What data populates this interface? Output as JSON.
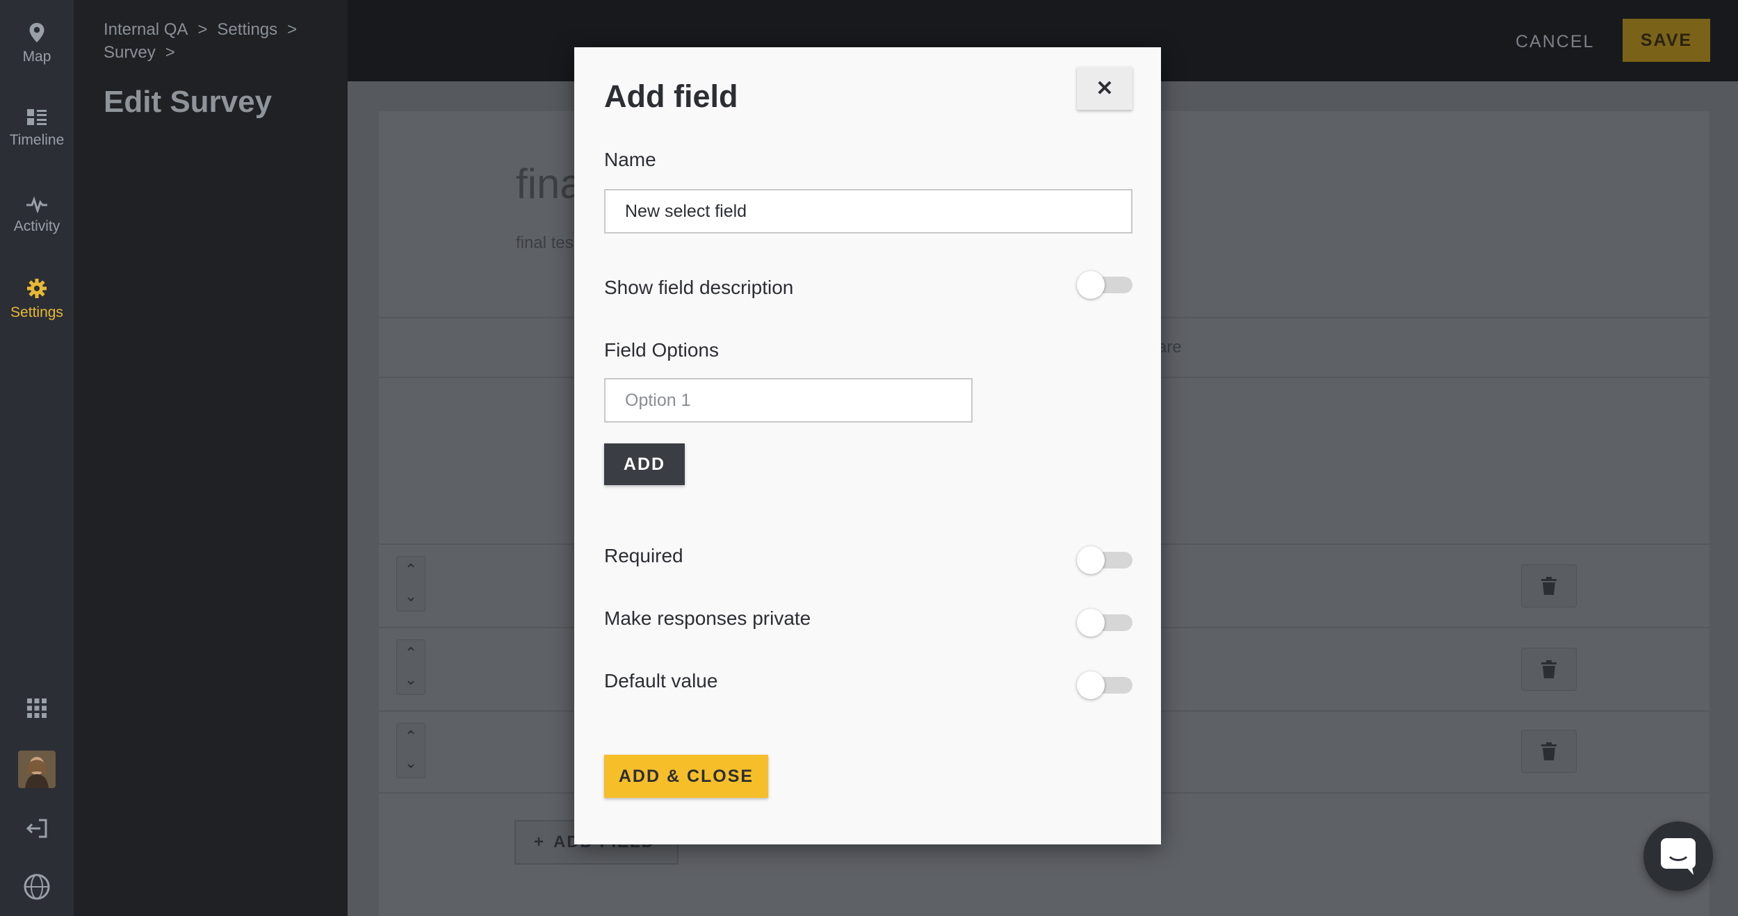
{
  "rail": {
    "items": [
      {
        "label": "Map",
        "icon": "map-pin-icon"
      },
      {
        "label": "Timeline",
        "icon": "timeline-icon"
      },
      {
        "label": "Activity",
        "icon": "activity-icon"
      },
      {
        "label": "Settings",
        "icon": "gear-icon"
      }
    ],
    "bottom_icons": [
      "apps-grid-icon",
      "avatar",
      "logout-icon",
      "globe-icon"
    ],
    "active_color": "#e9b935"
  },
  "sidebar": {
    "breadcrumb": [
      "Internal QA",
      "Settings",
      "Survey"
    ],
    "separator": ">",
    "title": "Edit Survey"
  },
  "header": {
    "cancel_label": "CANCEL",
    "save_label": "SAVE"
  },
  "background": {
    "survey_title_partial": "fina",
    "survey_desc_partial": "final tes",
    "share_partial": "are",
    "add_field_partial": "ADD FIELD"
  },
  "modal": {
    "title": "Add field",
    "close_icon": "close-icon",
    "name_label": "Name",
    "name_value": "New select field",
    "show_description_label": "Show field description",
    "field_options_label": "Field Options",
    "option_placeholder": "Option 1",
    "add_label": "ADD",
    "required_label": "Required",
    "private_label": "Make responses private",
    "default_value_label": "Default value",
    "add_close_label": "ADD & CLOSE",
    "accent_color": "#f6be29"
  }
}
